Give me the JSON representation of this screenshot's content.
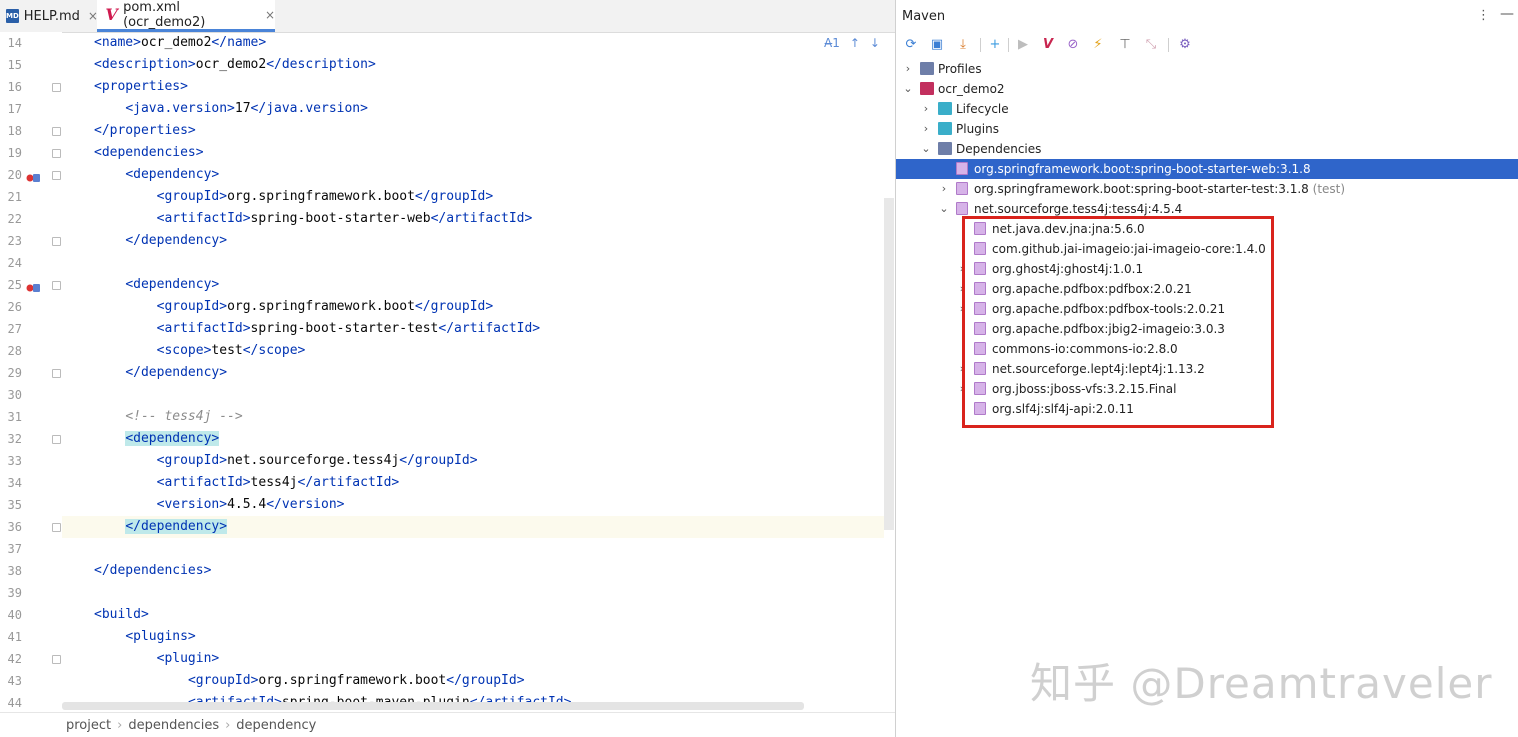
{
  "tabs": [
    {
      "label": "HELP.md",
      "icon": "markdown-file-icon",
      "icon_text": "MD"
    },
    {
      "label": "pom.xml (ocr_demo2)",
      "icon": "maven-file-icon",
      "icon_text": "V"
    }
  ],
  "tab_close_glyph": "×",
  "inspection": {
    "count": "1",
    "up": "↑",
    "down": "↓",
    "glyph": "A̶"
  },
  "lines": [
    {
      "n": "14",
      "indent": 1,
      "parts": [
        [
          "tg",
          "<name>"
        ],
        [
          "tx",
          "ocr_demo2"
        ],
        [
          "tg",
          "</name>"
        ]
      ]
    },
    {
      "n": "15",
      "indent": 1,
      "parts": [
        [
          "tg",
          "<description>"
        ],
        [
          "tx",
          "ocr_demo2"
        ],
        [
          "tg",
          "</description>"
        ]
      ]
    },
    {
      "n": "16",
      "indent": 1,
      "parts": [
        [
          "tg",
          "<properties>"
        ]
      ]
    },
    {
      "n": "17",
      "indent": 2,
      "parts": [
        [
          "tg",
          "<java.version>"
        ],
        [
          "tx",
          "17"
        ],
        [
          "tg",
          "</java.version>"
        ]
      ]
    },
    {
      "n": "18",
      "indent": 1,
      "parts": [
        [
          "tg",
          "</properties>"
        ]
      ]
    },
    {
      "n": "19",
      "indent": 1,
      "parts": [
        [
          "tg",
          "<dependencies>"
        ]
      ]
    },
    {
      "n": "20",
      "indent": 2,
      "parts": [
        [
          "tg",
          "<dependency>"
        ]
      ]
    },
    {
      "n": "21",
      "indent": 3,
      "parts": [
        [
          "tg",
          "<groupId>"
        ],
        [
          "tx",
          "org.springframework.boot"
        ],
        [
          "tg",
          "</groupId>"
        ]
      ]
    },
    {
      "n": "22",
      "indent": 3,
      "parts": [
        [
          "tg",
          "<artifactId>"
        ],
        [
          "tx",
          "spring-boot-starter-web"
        ],
        [
          "tg",
          "</artifactId>"
        ]
      ]
    },
    {
      "n": "23",
      "indent": 2,
      "parts": [
        [
          "tg",
          "</dependency>"
        ]
      ]
    },
    {
      "n": "24",
      "indent": 0,
      "parts": []
    },
    {
      "n": "25",
      "indent": 2,
      "parts": [
        [
          "tg",
          "<dependency>"
        ]
      ]
    },
    {
      "n": "26",
      "indent": 3,
      "parts": [
        [
          "tg",
          "<groupId>"
        ],
        [
          "tx",
          "org.springframework.boot"
        ],
        [
          "tg",
          "</groupId>"
        ]
      ]
    },
    {
      "n": "27",
      "indent": 3,
      "parts": [
        [
          "tg",
          "<artifactId>"
        ],
        [
          "tx",
          "spring-boot-starter-test"
        ],
        [
          "tg",
          "</artifactId>"
        ]
      ]
    },
    {
      "n": "28",
      "indent": 3,
      "parts": [
        [
          "tg",
          "<scope>"
        ],
        [
          "tx",
          "test"
        ],
        [
          "tg",
          "</scope>"
        ]
      ]
    },
    {
      "n": "29",
      "indent": 2,
      "parts": [
        [
          "tg",
          "</dependency>"
        ]
      ]
    },
    {
      "n": "30",
      "indent": 0,
      "parts": []
    },
    {
      "n": "31",
      "indent": 2,
      "parts": [
        [
          "cm",
          "<!-- tess4j -->"
        ]
      ]
    },
    {
      "n": "32",
      "indent": 2,
      "parts": [
        [
          "hl",
          "<dependency>"
        ]
      ]
    },
    {
      "n": "33",
      "indent": 3,
      "parts": [
        [
          "tg",
          "<groupId>"
        ],
        [
          "tx",
          "net.sourceforge.tess4j"
        ],
        [
          "tg",
          "</groupId>"
        ]
      ]
    },
    {
      "n": "34",
      "indent": 3,
      "parts": [
        [
          "tg",
          "<artifactId>"
        ],
        [
          "tx",
          "tess4j"
        ],
        [
          "tg",
          "</artifactId>"
        ]
      ]
    },
    {
      "n": "35",
      "indent": 3,
      "parts": [
        [
          "tg",
          "<version>"
        ],
        [
          "tx",
          "4.5.4"
        ],
        [
          "tg",
          "</version>"
        ]
      ]
    },
    {
      "n": "36",
      "indent": 2,
      "parts": [
        [
          "hl",
          "</dependency>"
        ]
      ]
    },
    {
      "n": "37",
      "indent": 0,
      "parts": []
    },
    {
      "n": "38",
      "indent": 1,
      "parts": [
        [
          "tg",
          "</dependencies>"
        ]
      ]
    },
    {
      "n": "39",
      "indent": 0,
      "parts": []
    },
    {
      "n": "40",
      "indent": 1,
      "parts": [
        [
          "tg",
          "<build>"
        ]
      ]
    },
    {
      "n": "41",
      "indent": 2,
      "parts": [
        [
          "tg",
          "<plugins>"
        ]
      ]
    },
    {
      "n": "42",
      "indent": 3,
      "parts": [
        [
          "tg",
          "<plugin>"
        ]
      ]
    },
    {
      "n": "43",
      "indent": 4,
      "parts": [
        [
          "tg",
          "<groupId>"
        ],
        [
          "tx",
          "org.springframework.boot"
        ],
        [
          "tg",
          "</groupId>"
        ]
      ]
    },
    {
      "n": "44",
      "indent": 4,
      "parts": [
        [
          "tg",
          "<artifactId>"
        ],
        [
          "tx",
          "spring-boot-maven-plugin"
        ],
        [
          "tg",
          "</artifactId>"
        ]
      ]
    }
  ],
  "breadcrumb": [
    "project",
    "dependencies",
    "dependency"
  ],
  "breadcrumb_sep": "›",
  "maven": {
    "title": "Maven",
    "more_glyph": "⋮",
    "minimize_glyph": "—",
    "toolbar": [
      {
        "name": "reload-icon",
        "glyph": "⟳",
        "color": "#3b7fd4"
      },
      {
        "name": "generate-sources-icon",
        "glyph": "▣",
        "color": "#3b7fd4"
      },
      {
        "name": "download-icon",
        "glyph": "⤓",
        "color": "#d97b2a"
      },
      {
        "name": "add-icon",
        "glyph": "+",
        "color": "#3b9be0"
      },
      {
        "name": "run-icon",
        "glyph": "▶",
        "color": "#bdbdbd"
      },
      {
        "name": "execute-goal-icon",
        "glyph": "V",
        "color": "#c8254f"
      },
      {
        "name": "skip-tests-icon",
        "glyph": "⊘",
        "color": "#9a64c9"
      },
      {
        "name": "offline-icon",
        "glyph": "⚡",
        "color": "#e3a21a"
      },
      {
        "name": "show-dependencies-icon",
        "glyph": "⊤",
        "color": "#6a6a6a"
      },
      {
        "name": "collapse-all-icon",
        "glyph": "⤡",
        "color": "#d0a0b0"
      },
      {
        "name": "settings-icon",
        "glyph": "⚙",
        "color": "#7a5fbf"
      }
    ],
    "tree": [
      {
        "label": "Profiles",
        "level": 0,
        "arrow": "›",
        "icon": "folder"
      },
      {
        "label": "ocr_demo2",
        "level": 0,
        "arrow": "⌄",
        "icon": "project"
      },
      {
        "label": "Lifecycle",
        "level": 1,
        "arrow": "›",
        "icon": "teal"
      },
      {
        "label": "Plugins",
        "level": 1,
        "arrow": "›",
        "icon": "teal"
      },
      {
        "label": "Dependencies",
        "level": 1,
        "arrow": "⌄",
        "icon": "folder"
      },
      {
        "label": "org.springframework.boot:spring-boot-starter-web:3.1.8",
        "level": 2,
        "arrow": "",
        "icon": "lib",
        "selected": true
      },
      {
        "label": "org.springframework.boot:spring-boot-starter-test:3.1.8",
        "suffix": "(test)",
        "level": 2,
        "arrow": "›",
        "icon": "lib"
      },
      {
        "label": "net.sourceforge.tess4j:tess4j:4.5.4",
        "level": 2,
        "arrow": "⌄",
        "icon": "lib"
      },
      {
        "label": "net.java.dev.jna:jna:5.6.0",
        "level": 3,
        "arrow": "",
        "icon": "lib"
      },
      {
        "label": "com.github.jai-imageio:jai-imageio-core:1.4.0",
        "level": 3,
        "arrow": "",
        "icon": "lib"
      },
      {
        "label": "org.ghost4j:ghost4j:1.0.1",
        "level": 3,
        "arrow": "›",
        "icon": "lib"
      },
      {
        "label": "org.apache.pdfbox:pdfbox:2.0.21",
        "level": 3,
        "arrow": "›",
        "icon": "lib"
      },
      {
        "label": "org.apache.pdfbox:pdfbox-tools:2.0.21",
        "level": 3,
        "arrow": "›",
        "icon": "lib"
      },
      {
        "label": "org.apache.pdfbox:jbig2-imageio:3.0.3",
        "level": 3,
        "arrow": "",
        "icon": "lib"
      },
      {
        "label": "commons-io:commons-io:2.8.0",
        "level": 3,
        "arrow": "",
        "icon": "lib"
      },
      {
        "label": "net.sourceforge.lept4j:lept4j:1.13.2",
        "level": 3,
        "arrow": "›",
        "icon": "lib"
      },
      {
        "label": "org.jboss:jboss-vfs:3.2.15.Final",
        "level": 3,
        "arrow": "›",
        "icon": "lib"
      },
      {
        "label": "org.slf4j:slf4j-api:2.0.11",
        "level": 3,
        "arrow": "",
        "icon": "lib"
      }
    ]
  },
  "watermark": "知乎 @Dreamtraveler",
  "colors": {
    "selection": "#2f65ca",
    "highlight_box": "#d9231c",
    "tag": "#0033b3",
    "tag_highlight": "#bfe9ea"
  }
}
